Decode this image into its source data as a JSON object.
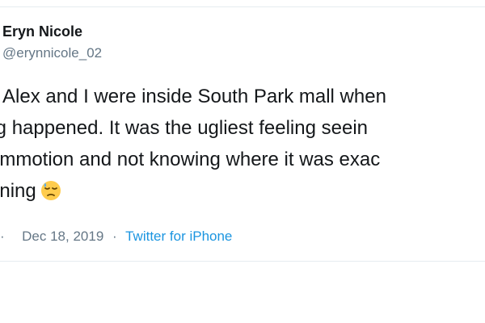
{
  "tweet": {
    "author_name": "Eryn Nicole",
    "author_handle": "@erynnicole_02",
    "text_lines": [
      "Alex and I were inside South Park mall when",
      "ing happened. It was the ugliest feeling seein",
      "ommotion and not knowing where it was exac",
      "ening"
    ],
    "emoji": "downcast-face-with-sweat-icon",
    "time_prefix": "·",
    "date": "Dec 18, 2019",
    "separator": "·",
    "source": "Twitter for iPhone"
  },
  "colors": {
    "text": "#14171a",
    "secondary_text": "#657786",
    "link": "#1b95e0",
    "border": "#e6ecf0",
    "emoji_face": "#ffcc4d",
    "emoji_sweat": "#5dadec"
  }
}
